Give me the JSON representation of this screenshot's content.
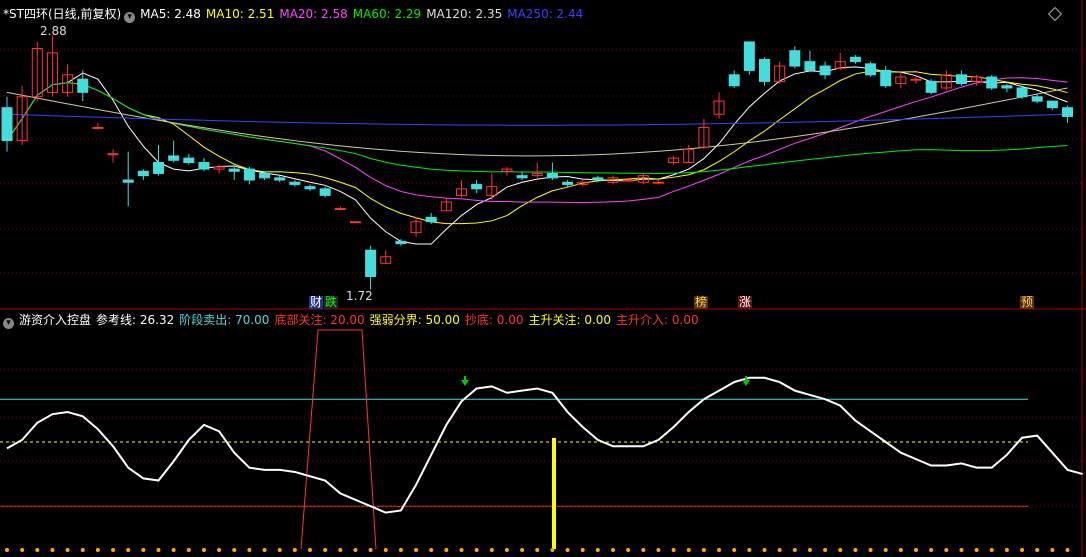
{
  "main_panel": {
    "title": "*ST四环(日线,前复权)",
    "indicators": [
      {
        "label": "MA5: 2.48",
        "color": "#ffffff"
      },
      {
        "label": "MA10: 2.51",
        "color": "#ffff00"
      },
      {
        "label": "MA20: 2.58",
        "color": "#ff44ff"
      },
      {
        "label": "MA60: 2.29",
        "color": "#00ee00"
      },
      {
        "label": "MA120: 2.35",
        "color": "#dddddd"
      },
      {
        "label": "MA250: 2.44",
        "color": "#3344ff"
      }
    ],
    "high_label": "2.88",
    "low_label": "1.72",
    "event_tags": [
      {
        "text": "财",
        "color": "#ffffff",
        "bg": "#223388"
      },
      {
        "text": "跌",
        "color": "#00ff00",
        "bg": "#222"
      },
      {
        "text": "榜",
        "color": "#ffcc66",
        "bg": "#553300"
      },
      {
        "text": "涨",
        "color": "#ffffff",
        "bg": "#661111"
      },
      {
        "text": "预",
        "color": "#ffcc66",
        "bg": "#553300"
      }
    ]
  },
  "sub_panel": {
    "title": "游资介入控盘",
    "indicators": [
      {
        "label": "参考线: 26.32",
        "color": "#ffffff"
      },
      {
        "label": "阶段卖出: 70.00",
        "color": "#44dddd"
      },
      {
        "label": "底部关注: 20.00",
        "color": "#ff3333"
      },
      {
        "label": "强弱分界: 50.00",
        "color": "#ffff00"
      },
      {
        "label": "抄底: 0.00",
        "color": "#ff3333"
      },
      {
        "label": "主升关注: 0.00",
        "color": "#ffff00"
      },
      {
        "label": "主升介入: 0.00",
        "color": "#ff3333"
      }
    ]
  },
  "colors": {
    "up": "#ff3333",
    "down": "#44dddd",
    "grid": "#8b0000"
  },
  "chart_data": {
    "type": "candlestick",
    "title": "*ST四环(日线,前复权)",
    "candles": [
      [
        2.55,
        2.4,
        2.6,
        2.35
      ],
      [
        2.4,
        2.6,
        2.65,
        2.38
      ],
      [
        2.6,
        2.82,
        2.85,
        2.58
      ],
      [
        2.62,
        2.8,
        2.88,
        2.6
      ],
      [
        2.62,
        2.7,
        2.75,
        2.6
      ],
      [
        2.68,
        2.62,
        2.72,
        2.58
      ],
      [
        2.46,
        2.46,
        2.48,
        2.45
      ],
      [
        2.34,
        2.34,
        2.36,
        2.3
      ],
      [
        2.22,
        2.21,
        2.35,
        2.1
      ],
      [
        2.26,
        2.24,
        2.27,
        2.22
      ],
      [
        2.3,
        2.25,
        2.38,
        2.24
      ],
      [
        2.33,
        2.31,
        2.4,
        2.3
      ],
      [
        2.32,
        2.3,
        2.34,
        2.29
      ],
      [
        2.3,
        2.27,
        2.32,
        2.26
      ],
      [
        2.27,
        2.28,
        2.29,
        2.25
      ],
      [
        2.27,
        2.26,
        2.28,
        2.22
      ],
      [
        2.27,
        2.22,
        2.28,
        2.2
      ],
      [
        2.25,
        2.23,
        2.26,
        2.22
      ],
      [
        2.23,
        2.22,
        2.24,
        2.21
      ],
      [
        2.21,
        2.2,
        2.22,
        2.19
      ],
      [
        2.19,
        2.18,
        2.2,
        2.17
      ],
      [
        2.18,
        2.15,
        2.19,
        2.14
      ],
      [
        2.09,
        2.09,
        2.1,
        2.08
      ],
      [
        2.03,
        2.03,
        2.03,
        2.03
      ],
      [
        1.9,
        1.78,
        1.92,
        1.72
      ],
      [
        1.84,
        1.87,
        1.9,
        1.84
      ],
      [
        1.94,
        1.93,
        1.95,
        1.92
      ],
      [
        1.98,
        2.03,
        2.05,
        1.96
      ],
      [
        2.05,
        2.03,
        2.07,
        2.02
      ],
      [
        2.08,
        2.12,
        2.14,
        2.08
      ],
      [
        2.15,
        2.18,
        2.22,
        2.14
      ],
      [
        2.2,
        2.18,
        2.22,
        2.16
      ],
      [
        2.15,
        2.19,
        2.25,
        2.13
      ],
      [
        2.26,
        2.27,
        2.28,
        2.24
      ],
      [
        2.24,
        2.23,
        2.26,
        2.22
      ],
      [
        2.24,
        2.25,
        2.3,
        2.23
      ],
      [
        2.25,
        2.23,
        2.3,
        2.22
      ],
      [
        2.21,
        2.2,
        2.22,
        2.19
      ],
      [
        2.2,
        2.21,
        2.22,
        2.19
      ],
      [
        2.23,
        2.22,
        2.24,
        2.21
      ],
      [
        2.21,
        2.23,
        2.24,
        2.2
      ],
      [
        2.22,
        2.22,
        2.23,
        2.21
      ],
      [
        2.21,
        2.24,
        2.25,
        2.2
      ],
      [
        2.21,
        2.21,
        2.22,
        2.2
      ],
      [
        2.3,
        2.32,
        2.33,
        2.29
      ],
      [
        2.3,
        2.36,
        2.38,
        2.3
      ],
      [
        2.37,
        2.46,
        2.5,
        2.36
      ],
      [
        2.52,
        2.58,
        2.62,
        2.5
      ],
      [
        2.7,
        2.65,
        2.72,
        2.64
      ],
      [
        2.85,
        2.72,
        2.85,
        2.7
      ],
      [
        2.77,
        2.67,
        2.78,
        2.65
      ],
      [
        2.67,
        2.74,
        2.76,
        2.66
      ],
      [
        2.81,
        2.74,
        2.83,
        2.73
      ],
      [
        2.76,
        2.72,
        2.81,
        2.72
      ],
      [
        2.74,
        2.7,
        2.76,
        2.68
      ],
      [
        2.73,
        2.76,
        2.8,
        2.72
      ],
      [
        2.78,
        2.76,
        2.79,
        2.75
      ],
      [
        2.75,
        2.7,
        2.76,
        2.69
      ],
      [
        2.72,
        2.65,
        2.74,
        2.64
      ],
      [
        2.66,
        2.69,
        2.71,
        2.64
      ],
      [
        2.68,
        2.68,
        2.7,
        2.66
      ],
      [
        2.67,
        2.62,
        2.68,
        2.61
      ],
      [
        2.64,
        2.7,
        2.72,
        2.63
      ],
      [
        2.7,
        2.66,
        2.72,
        2.65
      ],
      [
        2.67,
        2.69,
        2.7,
        2.65
      ],
      [
        2.69,
        2.64,
        2.7,
        2.63
      ],
      [
        2.65,
        2.64,
        2.66,
        2.62
      ],
      [
        2.64,
        2.6,
        2.65,
        2.59
      ],
      [
        2.6,
        2.58,
        2.61,
        2.57
      ],
      [
        2.58,
        2.55,
        2.58,
        2.54
      ],
      [
        2.55,
        2.51,
        2.56,
        2.48
      ]
    ],
    "ylim": [
      1.65,
      2.95
    ],
    "sub_chart": {
      "ylim": [
        0,
        100
      ],
      "reference_lines": {
        "阶段卖出": 70,
        "强弱分界": 50,
        "底部关注": 20
      },
      "oscillator": [
        47,
        51,
        59,
        63,
        64,
        62,
        56,
        48,
        38,
        33,
        32,
        41,
        51,
        58,
        55,
        45,
        38,
        37,
        37,
        36,
        34,
        32,
        26,
        23,
        20,
        17,
        18,
        30,
        44,
        58,
        69,
        75,
        76,
        73,
        74,
        75,
        73,
        64,
        57,
        51,
        48,
        48,
        48,
        51,
        57,
        64,
        70,
        74,
        78,
        80,
        80,
        78,
        74,
        72,
        70,
        67,
        60,
        55,
        50,
        45,
        42,
        39,
        39,
        40,
        38,
        38,
        44,
        52,
        53,
        45,
        37,
        35
      ]
    }
  }
}
